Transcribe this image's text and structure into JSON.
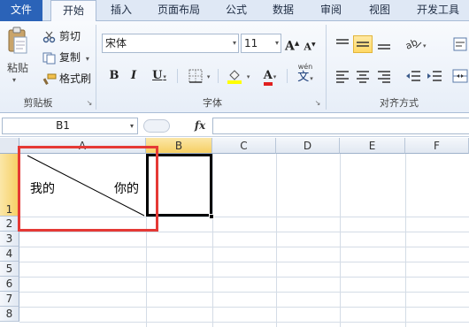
{
  "tabs": [
    "文件",
    "开始",
    "插入",
    "页面布局",
    "公式",
    "数据",
    "审阅",
    "视图",
    "开发工具"
  ],
  "clipboard": {
    "paste_label": "粘贴",
    "cut_label": "剪切",
    "copy_label": "复制",
    "copy_dropdown": "▾",
    "format_painter_label": "格式刷",
    "group_label": "剪贴板"
  },
  "font": {
    "name": "宋体",
    "size": "11",
    "bold": "B",
    "italic": "I",
    "underline": "U",
    "grow": "A",
    "shrink": "A",
    "wen": "wén",
    "wen_char": "文",
    "font_color_glyph": "A",
    "group_label": "字体"
  },
  "alignment": {
    "group_label": "对齐方式"
  },
  "formula_bar": {
    "name_box": "B1",
    "fx": "fx",
    "value": ""
  },
  "sheet": {
    "columns": [
      "A",
      "B",
      "C",
      "D",
      "E",
      "F"
    ],
    "selected_column": "B",
    "rows": [
      "1",
      "2",
      "3",
      "4",
      "5",
      "6",
      "7",
      "8"
    ],
    "selected_row": "1",
    "a1_left_text": "我的",
    "a1_right_text": "你的"
  },
  "colors": {
    "file_tab": "#2b63b8",
    "highlight_box": "#e53935",
    "selected_header": "#f6cf63",
    "font_color_bar": "#e02020",
    "fill_color_bar": "#ffff00"
  }
}
